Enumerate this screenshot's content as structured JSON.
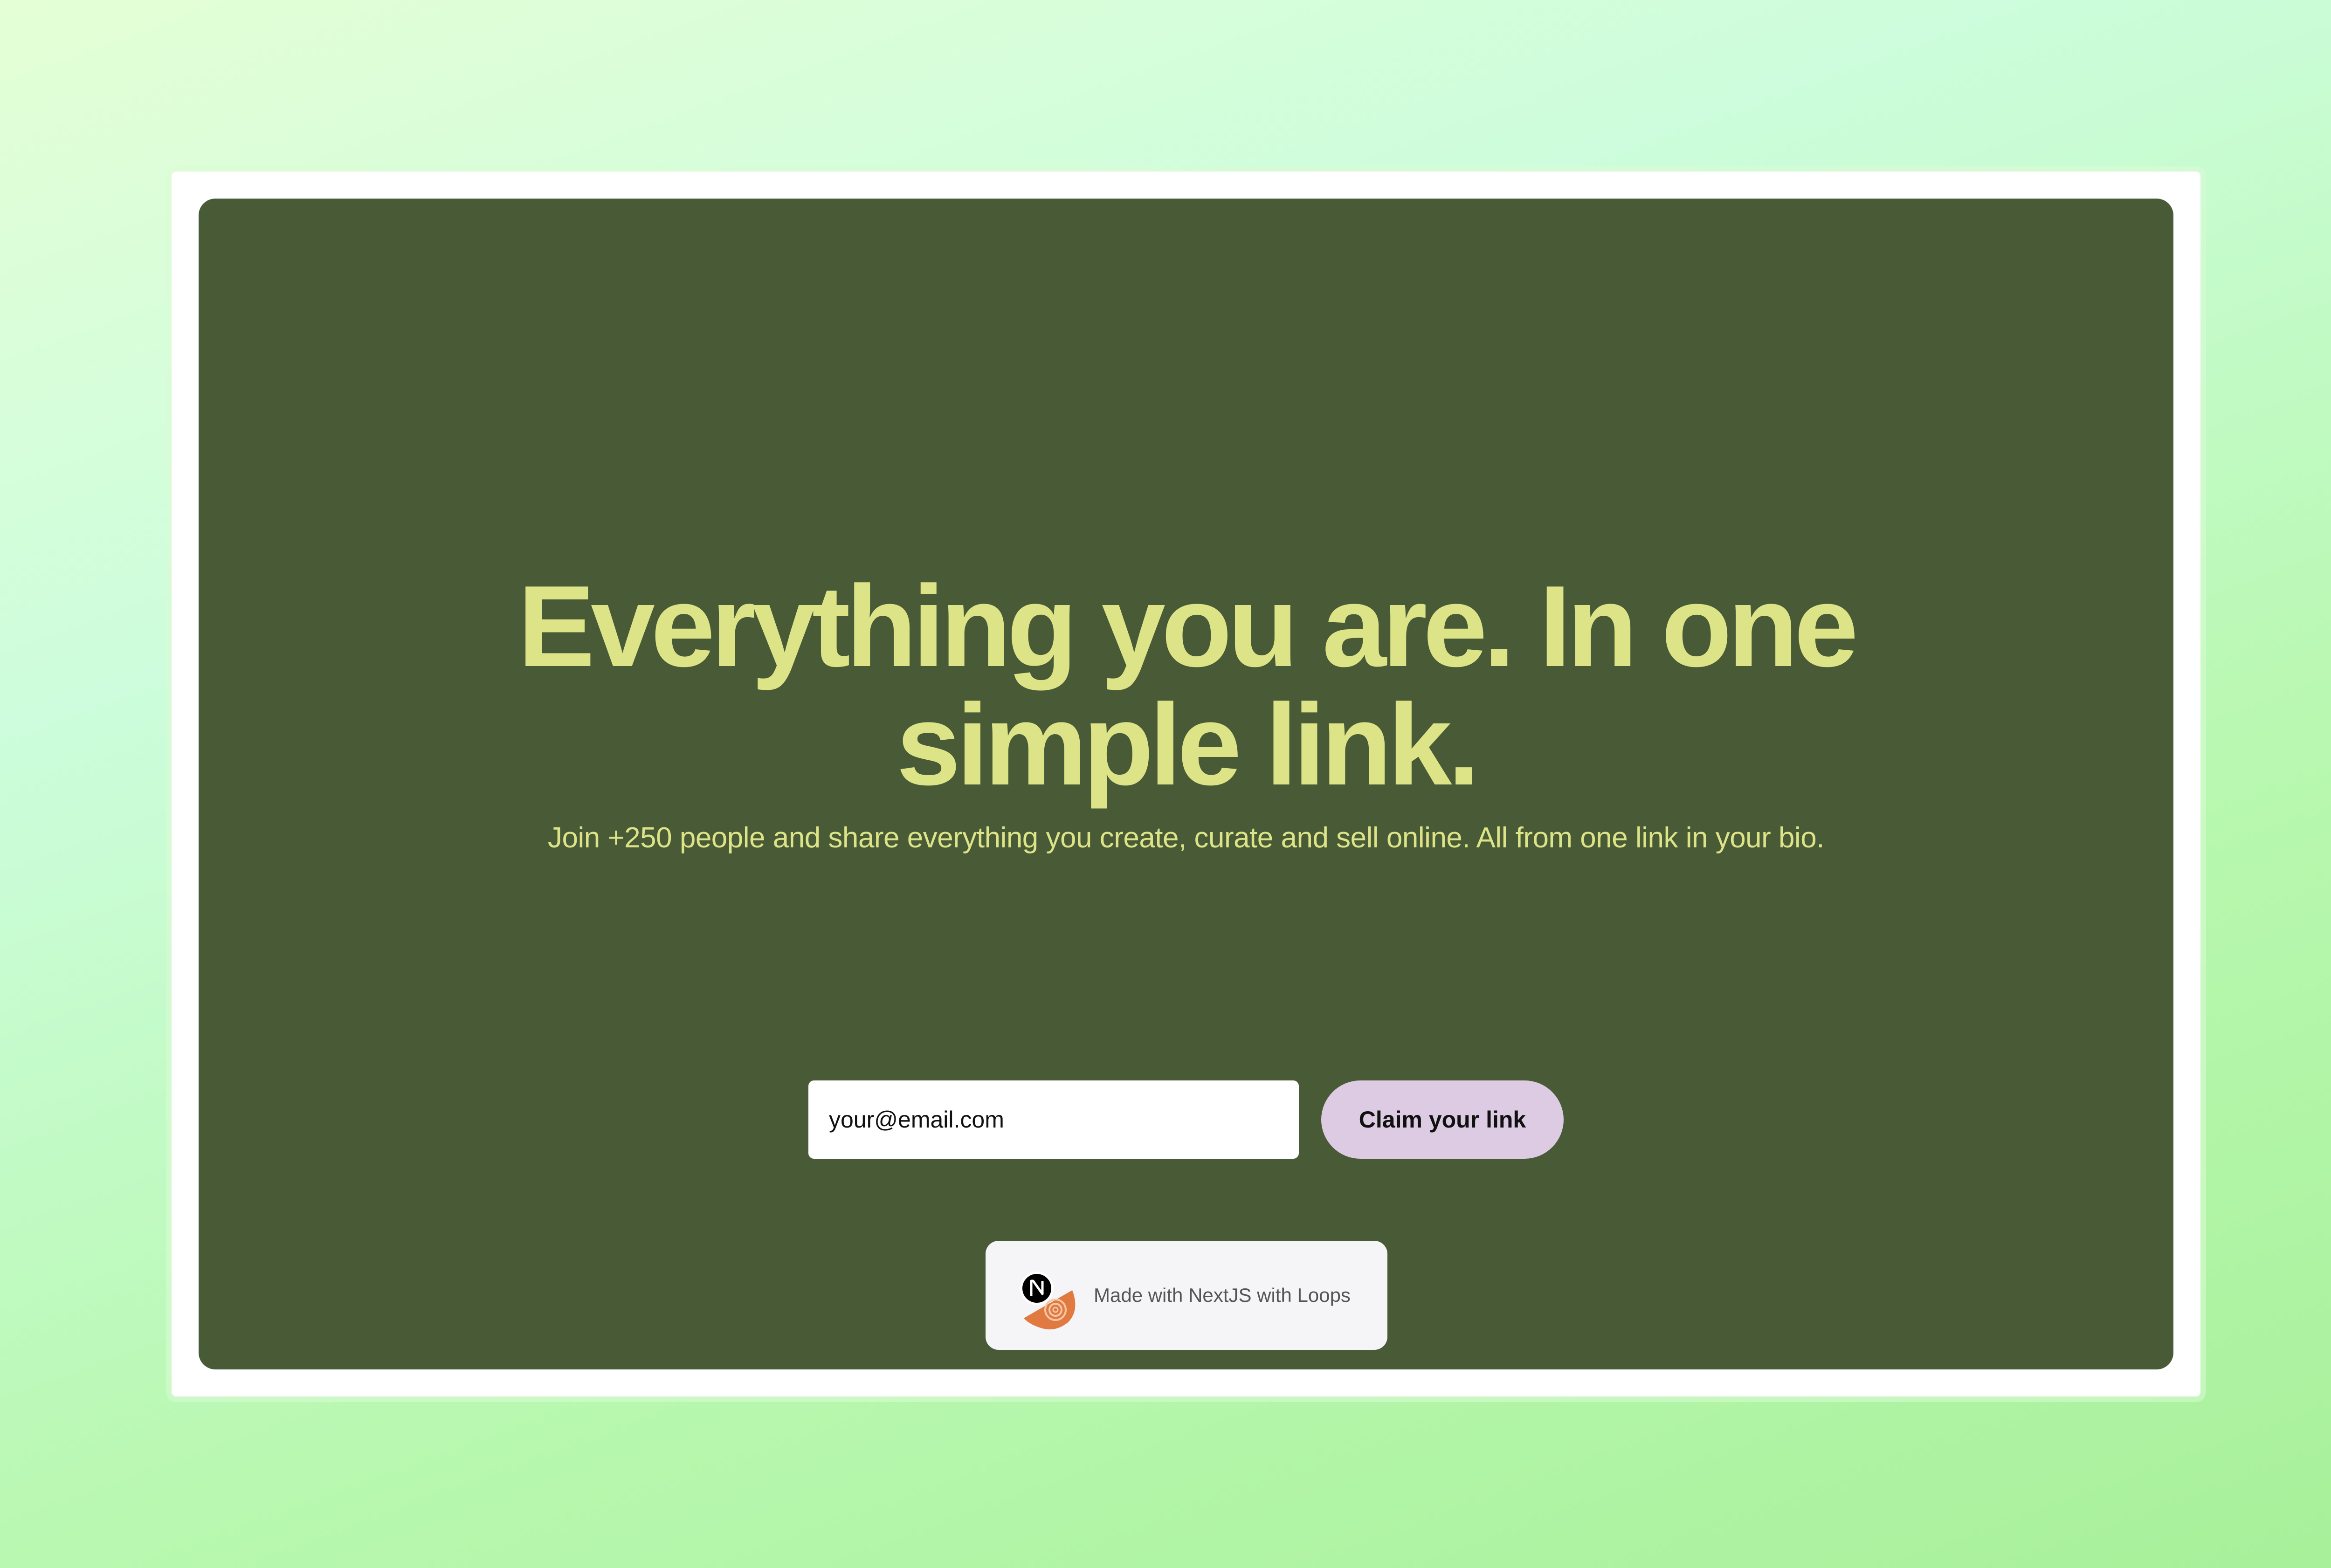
{
  "hero": {
    "headline": "Everything you are. In one simple link.",
    "subtitle": "Join +250 people and share everything you create, curate and sell online. All from one link in your bio."
  },
  "form": {
    "email_placeholder": "your@email.com",
    "claim_button_label": "Claim your link"
  },
  "badge": {
    "text": "Made with NextJS with Loops",
    "icons": [
      "nextjs-logo-icon",
      "loops-logo-icon"
    ]
  },
  "colors": {
    "card_background": "#485a36",
    "headline": "#dde387",
    "button": "#dccbe2",
    "page_gradient_start": "#e4ffd6",
    "page_gradient_end": "#a8f09a"
  }
}
